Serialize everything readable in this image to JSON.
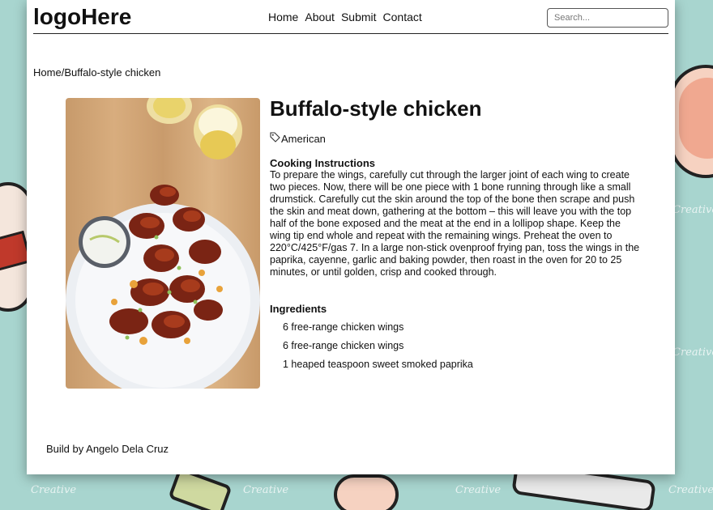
{
  "header": {
    "logo": "logoHere",
    "nav": [
      "Home",
      "About",
      "Submit",
      "Contact"
    ],
    "search_placeholder": "Search..."
  },
  "breadcrumb": {
    "home": "Home",
    "separator": "/",
    "current": "Buffalo-style chicken"
  },
  "recipe": {
    "title": "Buffalo-style chicken",
    "cuisine_icon": "tag-icon",
    "cuisine": "American",
    "instructions_title": "Cooking Instructions",
    "instructions": "To prepare the wings, carefully cut through the larger joint of each wing to create two pieces. Now, there will be one piece with 1 bone running through like a small drumstick. Carefully cut the skin around the top of the bone then scrape and push the skin and meat down, gathering at the bottom – this will leave you with the top half of the bone exposed and the meat at the end in a lollipop shape. Keep the wing tip end whole and repeat with the remaining wings. Preheat the oven to 220°C/425°F/gas 7. In a large non-stick ovenproof frying pan, toss the wings in the paprika, cayenne, garlic and baking powder, then roast in the oven for 20 to 25 minutes, or until golden, crisp and cooked through.",
    "ingredients_title": "Ingredients",
    "ingredients": [
      "6 free-range chicken wings",
      "6 free-range chicken wings",
      "1 heaped teaspoon sweet smoked paprika"
    ]
  },
  "footer": {
    "credit": "Build by Angelo Dela Cruz"
  },
  "background": {
    "watermark": "Creative"
  }
}
